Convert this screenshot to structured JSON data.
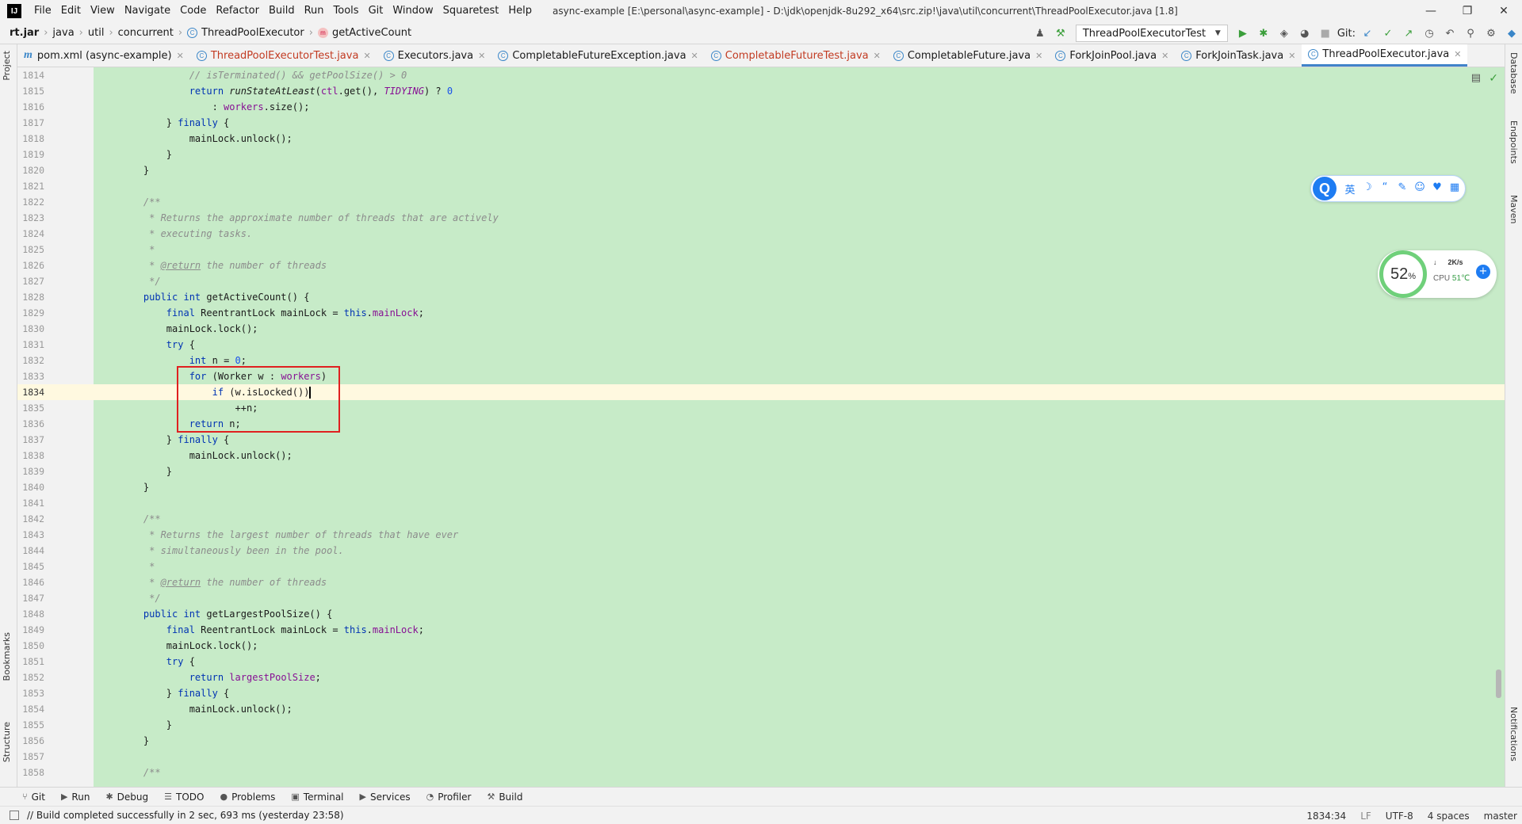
{
  "titlebar": {
    "logo": "IJ",
    "menu": [
      "File",
      "Edit",
      "View",
      "Navigate",
      "Code",
      "Refactor",
      "Build",
      "Run",
      "Tools",
      "Git",
      "Window",
      "Squaretest",
      "Help"
    ],
    "title": "async-example [E:\\personal\\async-example] - D:\\jdk\\openjdk-8u292_x64\\src.zip!\\java\\util\\concurrent\\ThreadPoolExecutor.java [1.8]"
  },
  "navbar": {
    "crumbs": [
      "rt.jar",
      "java",
      "util",
      "concurrent",
      "ThreadPoolExecutor",
      "getActiveCount"
    ],
    "class_badge": "C",
    "method_badge": "m",
    "run_config": "ThreadPoolExecutorTest",
    "git_label": "Git:"
  },
  "tabs": [
    {
      "label": "pom.xml (async-example)",
      "icon": "m",
      "style": "normal"
    },
    {
      "label": "ThreadPoolExecutorTest.java",
      "icon": "C",
      "style": "red"
    },
    {
      "label": "Executors.java",
      "icon": "C",
      "style": "normal"
    },
    {
      "label": "CompletableFutureException.java",
      "icon": "C",
      "style": "normal"
    },
    {
      "label": "CompletableFutureTest.java",
      "icon": "C",
      "style": "red"
    },
    {
      "label": "CompletableFuture.java",
      "icon": "C",
      "style": "normal"
    },
    {
      "label": "ForkJoinPool.java",
      "icon": "C",
      "style": "normal"
    },
    {
      "label": "ForkJoinTask.java",
      "icon": "C",
      "style": "normal"
    },
    {
      "label": "ThreadPoolExecutor.java",
      "icon": "C",
      "style": "active"
    }
  ],
  "side_tabs": {
    "left": [
      "Project",
      "Bookmarks",
      "Structure"
    ],
    "right": [
      "Database",
      "Endpoints",
      "Maven",
      "Notifications"
    ]
  },
  "editor": {
    "current_line": "1834",
    "lines": [
      {
        "n": "1814",
        "html": "            <span class=\"cm\">// isTerminated() &amp;&amp; getPoolSize() &gt; 0</span>"
      },
      {
        "n": "1815",
        "html": "            <span class=\"k\">return</span> <span class=\"it\">runStateAtLeast</span>(<span class=\"fld\">ctl</span>.get(), <span class=\"fld it\">TIDYING</span>) ? <span class=\"num\">0</span>"
      },
      {
        "n": "1816",
        "html": "                : <span class=\"fld\">workers</span>.size();"
      },
      {
        "n": "1817",
        "html": "        } <span class=\"k\">finally</span> {"
      },
      {
        "n": "1818",
        "html": "            mainLock.unlock();"
      },
      {
        "n": "1819",
        "html": "        }"
      },
      {
        "n": "1820",
        "html": "    }"
      },
      {
        "n": "1821",
        "html": ""
      },
      {
        "n": "1822",
        "html": "    <span class=\"cm\">/**</span>"
      },
      {
        "n": "1823",
        "html": "<span class=\"cm\">     * Returns the approximate number of threads that are actively</span>"
      },
      {
        "n": "1824",
        "html": "<span class=\"cm\">     * executing tasks.</span>"
      },
      {
        "n": "1825",
        "html": "<span class=\"cm\">     *</span>"
      },
      {
        "n": "1826",
        "html": "<span class=\"cm\">     * <span class=\"tag\">@return</span> the number of threads</span>"
      },
      {
        "n": "1827",
        "html": "<span class=\"cm\">     */</span>"
      },
      {
        "n": "1828",
        "html": "    <span class=\"k\">public int</span> getActiveCount() {"
      },
      {
        "n": "1829",
        "html": "        <span class=\"k\">final</span> ReentrantLock mainLock = <span class=\"k\">this</span>.<span class=\"fld\">mainLock</span>;"
      },
      {
        "n": "1830",
        "html": "        mainLock.lock();"
      },
      {
        "n": "1831",
        "html": "        <span class=\"k\">try</span> {"
      },
      {
        "n": "1832",
        "html": "            <span class=\"k\">int</span> n = <span class=\"num\">0</span>;"
      },
      {
        "n": "1833",
        "html": "            <span class=\"k\">for</span> (Worker w : <span class=\"fld\">workers</span>)"
      },
      {
        "n": "1834",
        "html": "                <span class=\"k\">if</span> (w.isLocked())<span class=\"caret\"></span>"
      },
      {
        "n": "1835",
        "html": "                    ++n;"
      },
      {
        "n": "1836",
        "html": "            <span class=\"k\">return</span> n;"
      },
      {
        "n": "1837",
        "html": "        } <span class=\"k\">finally</span> {"
      },
      {
        "n": "1838",
        "html": "            mainLock.unlock();"
      },
      {
        "n": "1839",
        "html": "        }"
      },
      {
        "n": "1840",
        "html": "    }"
      },
      {
        "n": "1841",
        "html": ""
      },
      {
        "n": "1842",
        "html": "    <span class=\"cm\">/**</span>"
      },
      {
        "n": "1843",
        "html": "<span class=\"cm\">     * Returns the largest number of threads that have ever</span>"
      },
      {
        "n": "1844",
        "html": "<span class=\"cm\">     * simultaneously been in the pool.</span>"
      },
      {
        "n": "1845",
        "html": "<span class=\"cm\">     *</span>"
      },
      {
        "n": "1846",
        "html": "<span class=\"cm\">     * <span class=\"tag\">@return</span> the number of threads</span>"
      },
      {
        "n": "1847",
        "html": "<span class=\"cm\">     */</span>"
      },
      {
        "n": "1848",
        "html": "    <span class=\"k\">public int</span> getLargestPoolSize() {"
      },
      {
        "n": "1849",
        "html": "        <span class=\"k\">final</span> ReentrantLock mainLock = <span class=\"k\">this</span>.<span class=\"fld\">mainLock</span>;"
      },
      {
        "n": "1850",
        "html": "        mainLock.lock();"
      },
      {
        "n": "1851",
        "html": "        <span class=\"k\">try</span> {"
      },
      {
        "n": "1852",
        "html": "            <span class=\"k\">return</span> <span class=\"fld\">largestPoolSize</span>;"
      },
      {
        "n": "1853",
        "html": "        } <span class=\"k\">finally</span> {"
      },
      {
        "n": "1854",
        "html": "            mainLock.unlock();"
      },
      {
        "n": "1855",
        "html": "        }"
      },
      {
        "n": "1856",
        "html": "    }"
      },
      {
        "n": "1857",
        "html": ""
      },
      {
        "n": "1858",
        "html": "    <span class=\"cm\">/**</span>"
      }
    ]
  },
  "overlays": {
    "ime": {
      "logo": "Q",
      "items": [
        "英",
        "☽",
        "“",
        "✎",
        "☺",
        "♥",
        "▦"
      ]
    },
    "cpu": {
      "percent": "52",
      "percent_sign": "%",
      "net_arrow": "↓",
      "net": "2K/s",
      "cpu_label": "CPU",
      "temp": "51℃"
    }
  },
  "bottom_tools": [
    {
      "icon": "⑂",
      "label": "Git"
    },
    {
      "icon": "▶",
      "label": "Run"
    },
    {
      "icon": "✱",
      "label": "Debug"
    },
    {
      "icon": "☰",
      "label": "TODO"
    },
    {
      "icon": "●",
      "label": "Problems"
    },
    {
      "icon": "▣",
      "label": "Terminal"
    },
    {
      "icon": "▶",
      "label": "Services"
    },
    {
      "icon": "◔",
      "label": "Profiler"
    },
    {
      "icon": "⚒",
      "label": "Build"
    }
  ],
  "status": {
    "message": "// Build completed successfully in 2 sec, 693 ms (yesterday 23:58)",
    "position": "1834:34",
    "line_sep": "LF",
    "encoding": "UTF-8",
    "indent": "4 spaces",
    "branch": "master"
  },
  "colors": {
    "editor_bg": "#c7ebc8",
    "highlight_box": "#e02020",
    "active_tab_underline": "#4083c9"
  }
}
